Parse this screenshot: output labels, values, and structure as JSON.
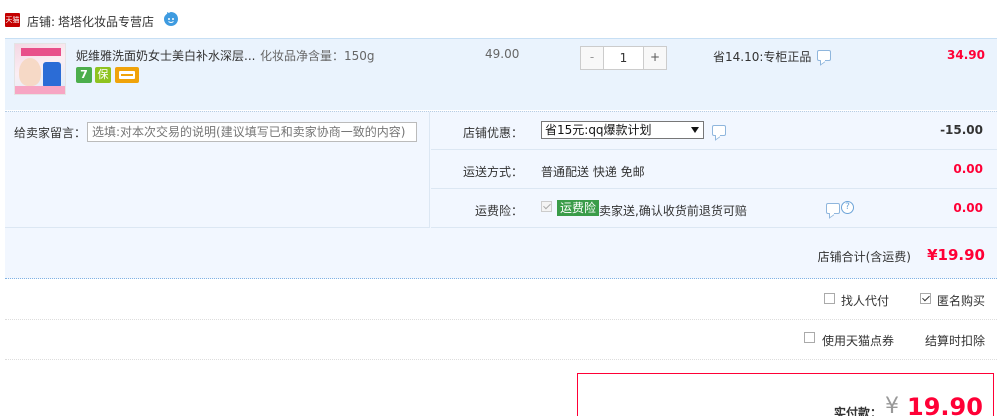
{
  "shop": {
    "logo_text": "天猫",
    "prefix": "店铺:",
    "name": "塔塔化妆品专营店"
  },
  "item": {
    "title": "妮维雅洗面奶女士美白补水深层...",
    "sku": "化妆品净含量：150g",
    "badges": [
      "7",
      "保",
      "card"
    ],
    "unit_price": "49.00",
    "quantity": "1",
    "minus_label": "-",
    "plus_label": "+",
    "discount_text": "省14.10:专柜正品",
    "subtotal": "34.90"
  },
  "order": {
    "memo_label": "给卖家留言：",
    "memo_placeholder": "选填:对本次交易的说明(建议填写已和卖家协商一致的内容)",
    "promo": {
      "label": "店铺优惠：",
      "selected": "省15元:qq爆款计划",
      "amount": "-15.00"
    },
    "shipping": {
      "label": "运送方式：",
      "value": "普通配送 快递 免邮",
      "amount": "0.00"
    },
    "insurance": {
      "label": "运费险：",
      "badge": "运费险",
      "text": "卖家送,确认收货前退货可赔",
      "amount": "0.00"
    },
    "shop_total_label": "店铺合计(含运费)",
    "shop_total": "¥19.90"
  },
  "options": {
    "proxy_pay": "找人代付",
    "anonymous": "匿名购买",
    "tmall_coupon": "使用天猫点券",
    "deduct": "结算时扣除"
  },
  "payment": {
    "label": "实付款：",
    "currency": "¥",
    "amount": "19.90"
  },
  "colors": {
    "price_red": "#ff0036",
    "panel_blue": "#eaf3fd",
    "insurance_green": "#3a9c49"
  }
}
